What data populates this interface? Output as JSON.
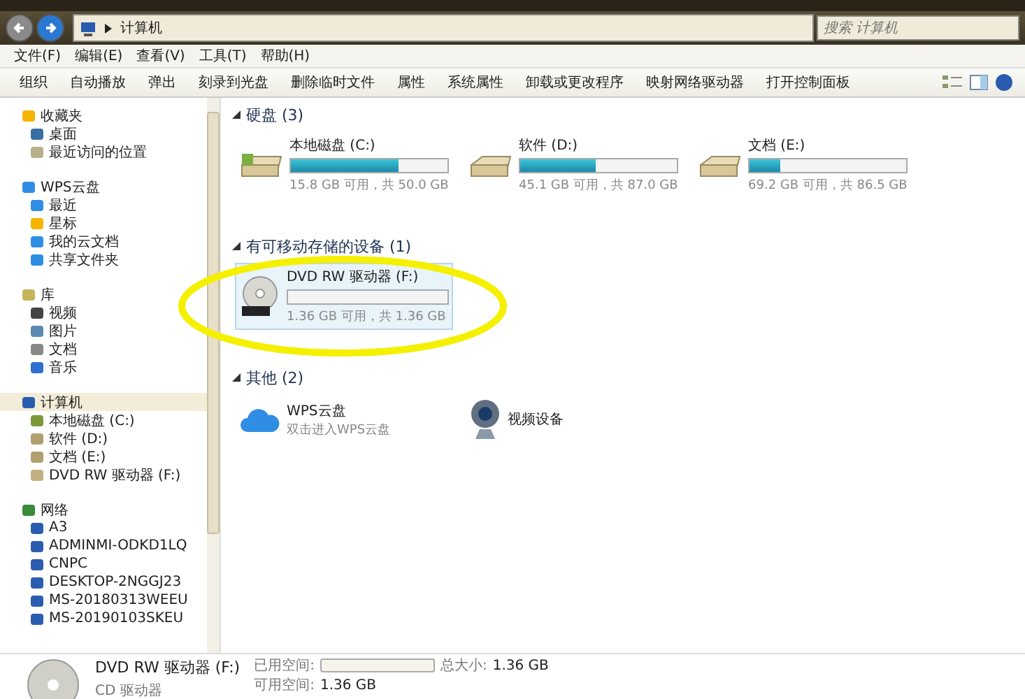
{
  "address": {
    "path": "计算机",
    "search_placeholder": "搜索 计算机"
  },
  "menu": [
    "文件(F)",
    "编辑(E)",
    "查看(V)",
    "工具(T)",
    "帮助(H)"
  ],
  "toolbar": [
    "组织",
    "自动播放",
    "弹出",
    "刻录到光盘",
    "删除临时文件",
    "属性",
    "系统属性",
    "卸载或更改程序",
    "映射网络驱动器",
    "打开控制面板"
  ],
  "sidebar": [
    {
      "label": "收藏夹",
      "kind": "star",
      "selected": false,
      "children": [
        {
          "label": "桌面",
          "kind": "desktop"
        },
        {
          "label": "最近访问的位置",
          "kind": "recent"
        }
      ]
    },
    {
      "label": "WPS云盘",
      "kind": "cloud",
      "selected": false,
      "children": [
        {
          "label": "最近",
          "kind": "clock"
        },
        {
          "label": "星标",
          "kind": "star"
        },
        {
          "label": "我的云文档",
          "kind": "cloud"
        },
        {
          "label": "共享文件夹",
          "kind": "share"
        }
      ]
    },
    {
      "label": "库",
      "kind": "library",
      "selected": false,
      "children": [
        {
          "label": "视频",
          "kind": "video"
        },
        {
          "label": "图片",
          "kind": "picture"
        },
        {
          "label": "文档",
          "kind": "doc"
        },
        {
          "label": "音乐",
          "kind": "music"
        }
      ]
    },
    {
      "label": "计算机",
      "kind": "computer",
      "selected": true,
      "children": [
        {
          "label": "本地磁盘 (C:)",
          "kind": "sysdisk"
        },
        {
          "label": "软件 (D:)",
          "kind": "disk"
        },
        {
          "label": "文档 (E:)",
          "kind": "disk"
        },
        {
          "label": "DVD RW 驱动器 (F:)",
          "kind": "dvd"
        }
      ]
    },
    {
      "label": "网络",
      "kind": "network",
      "selected": false,
      "children": [
        {
          "label": "A3",
          "kind": "pc"
        },
        {
          "label": "ADMINMI-ODKD1LQ",
          "kind": "pc"
        },
        {
          "label": "CNPC",
          "kind": "pc"
        },
        {
          "label": "DESKTOP-2NGGJ23",
          "kind": "pc"
        },
        {
          "label": "MS-20180313WEEU",
          "kind": "pc"
        },
        {
          "label": "MS-20190103SKEU",
          "kind": "pc"
        }
      ]
    }
  ],
  "groups": [
    {
      "title": "硬盘 (3)",
      "items": [
        {
          "kind": "sysdisk",
          "name": "本地磁盘 (C:)",
          "level": 0.684,
          "detail": "15.8 GB 可用，共 50.0 GB",
          "selected": false
        },
        {
          "kind": "disk",
          "name": "软件 (D:)",
          "level": 0.482,
          "detail": "45.1 GB 可用，共 87.0 GB",
          "selected": false
        },
        {
          "kind": "disk",
          "name": "文档 (E:)",
          "level": 0.2,
          "detail": "69.2 GB 可用，共 86.5 GB",
          "selected": false
        }
      ]
    },
    {
      "title": "有可移动存储的设备 (1)",
      "items": [
        {
          "kind": "dvd",
          "name": "DVD RW 驱动器 (F:)",
          "level": 0,
          "detail": "1.36 GB 可用，共 1.36 GB",
          "selected": true
        }
      ]
    },
    {
      "title": "其他 (2)",
      "items": [
        {
          "kind": "cloud",
          "name": "WPS云盘",
          "detail": "双击进入WPS云盘",
          "selected": false
        },
        {
          "kind": "webcam",
          "name": "视频设备",
          "selected": false
        }
      ]
    }
  ],
  "status": {
    "name": "DVD RW 驱动器 (F:)",
    "type": "CD 驱动器",
    "used_label": "已用空间:",
    "level": 0,
    "total_label": "总大小:",
    "total": "1.36 GB",
    "free_label": "可用空间:",
    "free": "1.36 GB"
  }
}
